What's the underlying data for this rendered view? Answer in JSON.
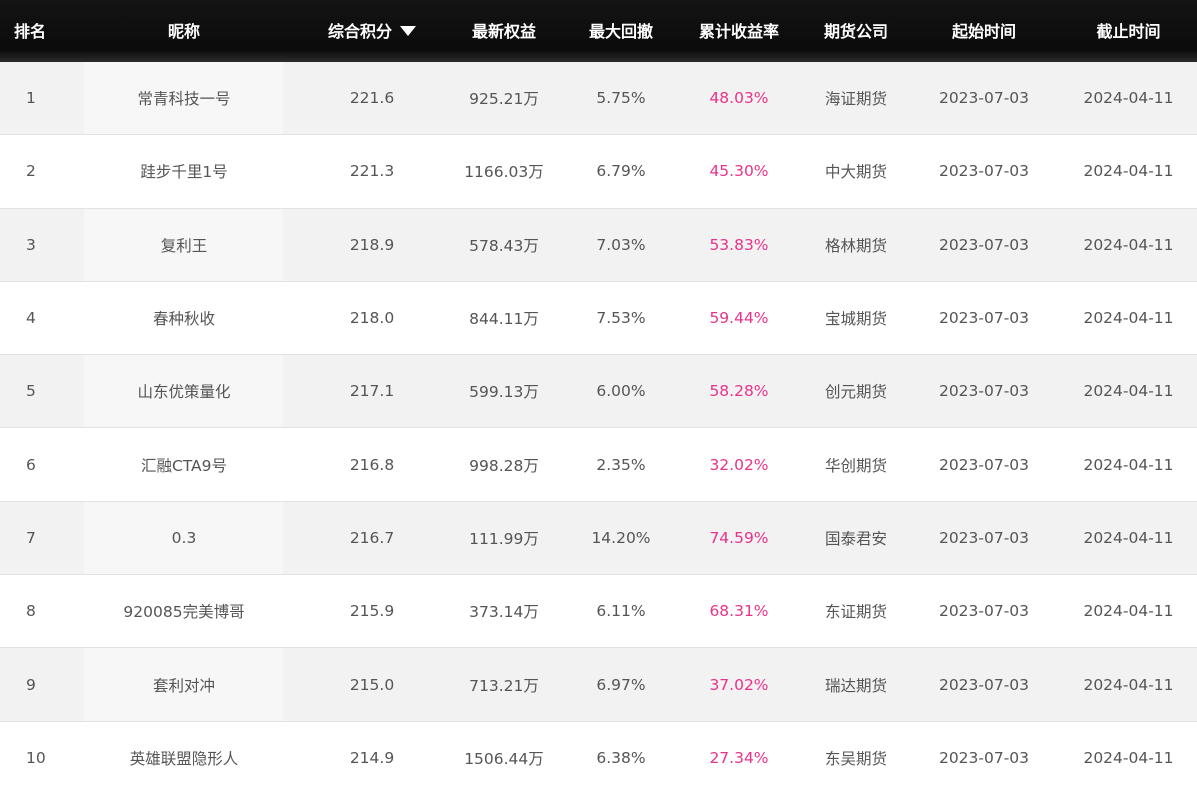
{
  "header": {
    "rank": "排名",
    "nickname": "昵称",
    "score": "综合积分",
    "equity": "最新权益",
    "drawdown": "最大回撤",
    "return_rate": "累计收益率",
    "company": "期货公司",
    "start": "起始时间",
    "end": "截止时间",
    "sort_icon": "caret-down-icon"
  },
  "colors": {
    "header_bg": "#111111",
    "rate_color": "#e8338a",
    "text_color": "#555555",
    "odd_row_bg": "#f2f2f2"
  },
  "rows": [
    {
      "rank": "1",
      "nickname": "常青科技一号",
      "score": "221.6",
      "equity": "925.21万",
      "drawdown": "5.75%",
      "return_rate": "48.03%",
      "company": "海证期货",
      "start": "2023-07-03",
      "end": "2024-04-11"
    },
    {
      "rank": "2",
      "nickname": "跬步千里1号",
      "score": "221.3",
      "equity": "1166.03万",
      "drawdown": "6.79%",
      "return_rate": "45.30%",
      "company": "中大期货",
      "start": "2023-07-03",
      "end": "2024-04-11"
    },
    {
      "rank": "3",
      "nickname": "复利王",
      "score": "218.9",
      "equity": "578.43万",
      "drawdown": "7.03%",
      "return_rate": "53.83%",
      "company": "格林期货",
      "start": "2023-07-03",
      "end": "2024-04-11"
    },
    {
      "rank": "4",
      "nickname": "春种秋收",
      "score": "218.0",
      "equity": "844.11万",
      "drawdown": "7.53%",
      "return_rate": "59.44%",
      "company": "宝城期货",
      "start": "2023-07-03",
      "end": "2024-04-11"
    },
    {
      "rank": "5",
      "nickname": "山东优策量化",
      "score": "217.1",
      "equity": "599.13万",
      "drawdown": "6.00%",
      "return_rate": "58.28%",
      "company": "创元期货",
      "start": "2023-07-03",
      "end": "2024-04-11"
    },
    {
      "rank": "6",
      "nickname": "汇融CTA9号",
      "score": "216.8",
      "equity": "998.28万",
      "drawdown": "2.35%",
      "return_rate": "32.02%",
      "company": "华创期货",
      "start": "2023-07-03",
      "end": "2024-04-11"
    },
    {
      "rank": "7",
      "nickname": "0.3",
      "score": "216.7",
      "equity": "111.99万",
      "drawdown": "14.20%",
      "return_rate": "74.59%",
      "company": "国泰君安",
      "start": "2023-07-03",
      "end": "2024-04-11"
    },
    {
      "rank": "8",
      "nickname": "920085完美博哥",
      "score": "215.9",
      "equity": "373.14万",
      "drawdown": "6.11%",
      "return_rate": "68.31%",
      "company": "东证期货",
      "start": "2023-07-03",
      "end": "2024-04-11"
    },
    {
      "rank": "9",
      "nickname": "套利对冲",
      "score": "215.0",
      "equity": "713.21万",
      "drawdown": "6.97%",
      "return_rate": "37.02%",
      "company": "瑞达期货",
      "start": "2023-07-03",
      "end": "2024-04-11"
    },
    {
      "rank": "10",
      "nickname": "英雄联盟隐形人",
      "score": "214.9",
      "equity": "1506.44万",
      "drawdown": "6.38%",
      "return_rate": "27.34%",
      "company": "东吴期货",
      "start": "2023-07-03",
      "end": "2024-04-11"
    }
  ]
}
